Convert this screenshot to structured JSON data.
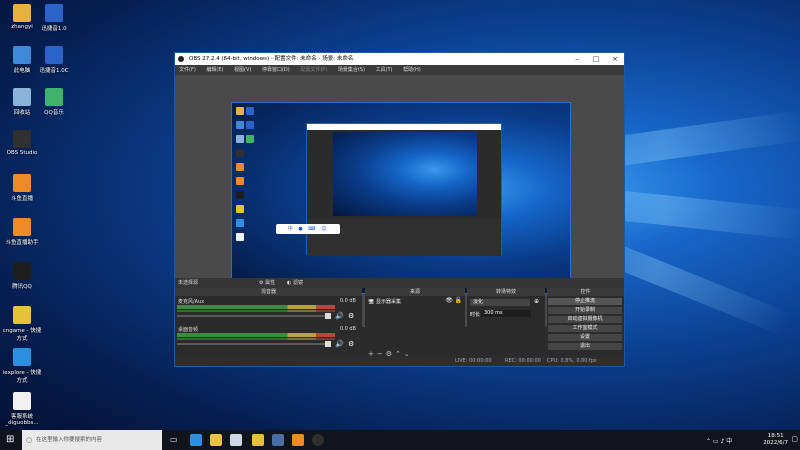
{
  "desktop": {
    "icons": [
      {
        "label": "zhangyi",
        "color": "#e7b23b"
      },
      {
        "label": "迅捷音1.0",
        "color": "#2a64c8"
      },
      {
        "label": "此电脑",
        "color": "#3e8ad8"
      },
      {
        "label": "迅捷音1.0C",
        "color": "#2a64c8"
      },
      {
        "label": "回收站",
        "color": "#8ab3d9"
      },
      {
        "label": "QQ音乐",
        "color": "#3db36b"
      },
      {
        "label": "OBS Studio",
        "color": "#303030"
      },
      {
        "label": "斗鱼直播",
        "color": "#f08a24"
      },
      {
        "label": "斗鱼直播助手",
        "color": "#f08a24"
      },
      {
        "label": "腾讯QQ",
        "color": "#1e1e1e"
      },
      {
        "label": "cngame - 快捷方式",
        "color": "#e6c238"
      },
      {
        "label": "iexplore - 快捷方式",
        "color": "#2d8fe0"
      },
      {
        "label": "客服系统_diguobbs...",
        "color": "#f0f0f0"
      }
    ]
  },
  "obs": {
    "title": "OBS 27.2.4 (64-bit, windows) - 配置文件: 未命名 - 场景: 未命名",
    "menu": [
      "文件(F)",
      "编辑(E)",
      "视图(V)",
      "停靠窗口(D)",
      "配置文件(P)",
      "场景集合(S)",
      "工具(T)",
      "帮助(H)"
    ],
    "source_bar": {
      "label": "未选择源",
      "properties": "属性",
      "filters": "滤镜"
    },
    "mixer": {
      "title": "混音器",
      "tracks": [
        {
          "name": "桌面音频",
          "value": "0.0 dB"
        },
        {
          "name": "麦克风/Aux",
          "value": "0.0 dB"
        }
      ]
    },
    "sources": {
      "title": "来源",
      "items": [
        "显示器采集"
      ]
    },
    "transitions": {
      "title": "转场特效",
      "type": "淡化",
      "duration_label": "时长",
      "duration_value": "300 ms"
    },
    "controls": {
      "title": "控件",
      "buttons": [
        "停止推流",
        "开始录制",
        "启动虚拟摄像机",
        "工作室模式",
        "设置",
        "退出"
      ]
    },
    "status": {
      "live": "LIVE: 00:00:00",
      "rec": "REC: 00:00:00",
      "cpu": "CPU: 0.8%, 0.00 fps"
    }
  },
  "taskbar": {
    "search_placeholder": "在这里输入你要搜索的内容",
    "time": "18:51",
    "date": "2022/6/7",
    "ime": "中"
  }
}
